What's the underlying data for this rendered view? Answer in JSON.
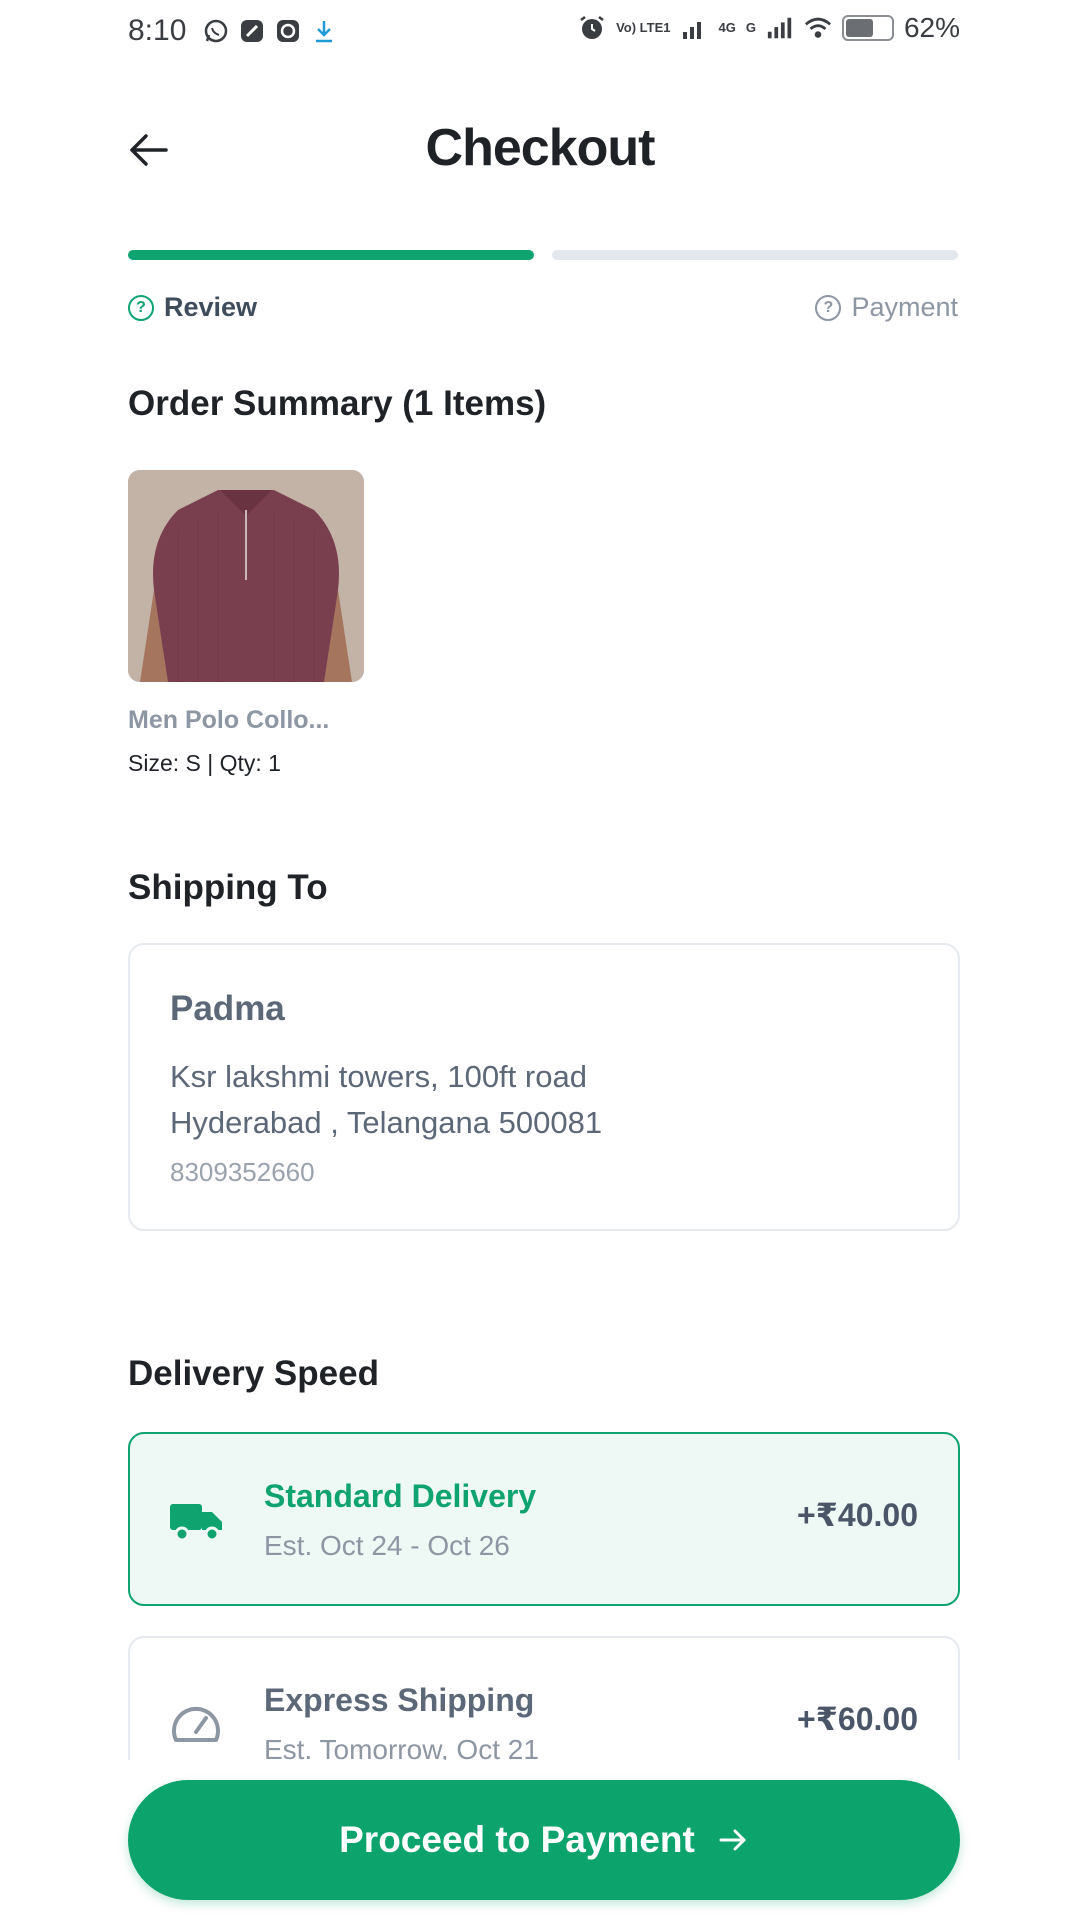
{
  "status_bar": {
    "time": "8:10",
    "battery_percent": "62%",
    "battery_level": 0.62,
    "network_label_top": "Vo) LTE1",
    "network_4g": "4G",
    "network_g": "G",
    "icons": [
      "whatsapp-icon",
      "app-icon",
      "camera-app-icon",
      "download-icon",
      "alarm-icon",
      "signal-icon",
      "wifi-icon",
      "battery-icon"
    ]
  },
  "header": {
    "title": "Checkout",
    "back_icon": "arrow-left-icon"
  },
  "progress": {
    "steps": [
      {
        "label": "Review",
        "active": true
      },
      {
        "label": "Payment",
        "active": false
      }
    ],
    "current_step": 1,
    "total_steps": 2
  },
  "order_summary": {
    "title": "Order Summary (1 Items)",
    "items": [
      {
        "name": "Men Polo Collo...",
        "meta": "Size: S | Qty: 1"
      }
    ]
  },
  "shipping": {
    "title": "Shipping To",
    "name": "Padma",
    "address_line1": "Ksr lakshmi towers, 100ft road",
    "address_line2": "Hyderabad , Telangana 500081",
    "phone": "8309352660"
  },
  "delivery": {
    "title": "Delivery Speed",
    "options": [
      {
        "name": "Standard Delivery",
        "estimate": "Est. Oct 24 - Oct 26",
        "price": "+₹40.00",
        "icon": "truck-icon",
        "selected": true
      },
      {
        "name": "Express Shipping",
        "estimate": "Est. Tomorrow, Oct 21",
        "price": "+₹60.00",
        "icon": "speedometer-icon",
        "selected": false
      }
    ]
  },
  "cta": {
    "label": "Proceed to Payment",
    "icon": "arrow-right-icon"
  },
  "colors": {
    "accent": "#0ea36f",
    "text_dark": "#1f2328",
    "text_muted": "#8d96a3",
    "card_border": "#e6e9ee",
    "selected_bg": "#eef8f4"
  }
}
